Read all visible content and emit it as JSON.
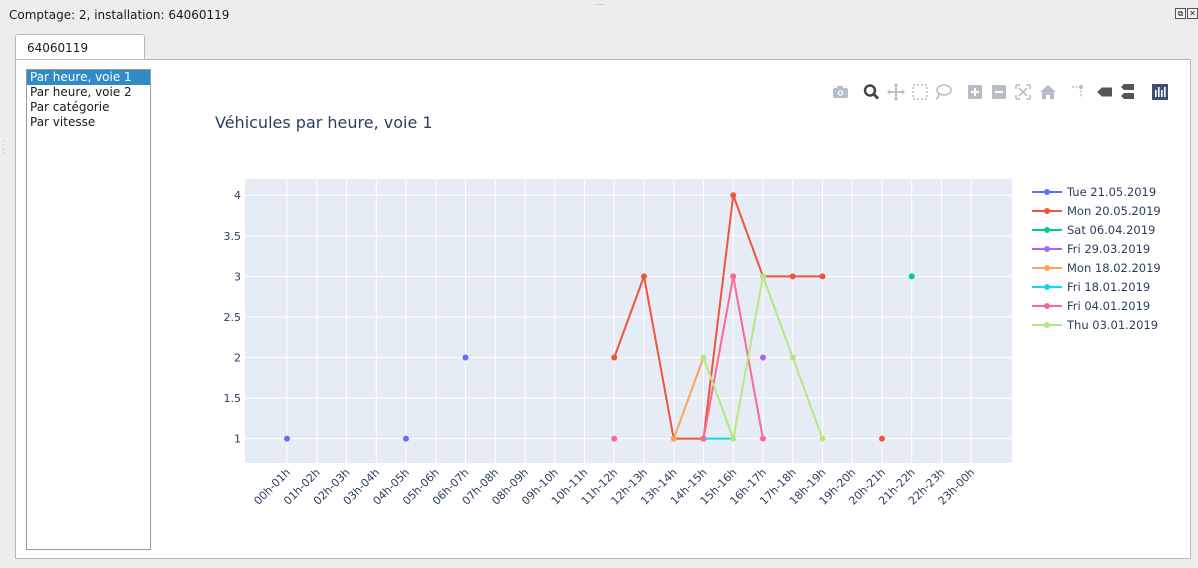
{
  "window": {
    "title": "Comptage: 2, installation: 64060119",
    "restore_icon": "restore-icon",
    "close_icon": "close-icon"
  },
  "tabs": [
    {
      "label": "64060119"
    }
  ],
  "sidebar": {
    "items": [
      {
        "label": "Par heure, voie 1",
        "selected": true
      },
      {
        "label": "Par heure, voie 2",
        "selected": false
      },
      {
        "label": "Par catégorie",
        "selected": false
      },
      {
        "label": "Par vitesse",
        "selected": false
      }
    ]
  },
  "modebar": {
    "buttons": [
      "camera-icon",
      "zoom-icon",
      "pan-icon",
      "box-select-icon",
      "lasso-select-icon",
      "zoom-in-icon",
      "zoom-out-icon",
      "autoscale-icon",
      "reset-axes-icon",
      "spike-lines-icon",
      "hover-closest-icon",
      "hover-compare-icon",
      "plotly-logo-icon"
    ],
    "active": [
      "zoom-icon"
    ]
  },
  "chart_data": {
    "type": "line",
    "title": "Véhicules par heure, voie 1",
    "categories": [
      "00h-01h",
      "01h-02h",
      "02h-03h",
      "03h-04h",
      "04h-05h",
      "05h-06h",
      "06h-07h",
      "07h-08h",
      "08h-09h",
      "09h-10h",
      "10h-11h",
      "11h-12h",
      "12h-13h",
      "13h-14h",
      "14h-15h",
      "15h-16h",
      "16h-17h",
      "17h-18h",
      "18h-19h",
      "19h-20h",
      "20h-21h",
      "21h-22h",
      "22h-23h",
      "23h-00h"
    ],
    "ylim": [
      0.7,
      4.2
    ],
    "yticks": [
      1,
      1.5,
      2,
      2.5,
      3,
      3.5,
      4
    ],
    "ytick_labels": [
      "1",
      "1.5",
      "2",
      "2.5",
      "3",
      "3.5",
      "4"
    ],
    "grid": true,
    "legend_position": "right",
    "series": [
      {
        "name": "Tue 21.05.2019",
        "color": "#636efa",
        "values": [
          1,
          null,
          null,
          null,
          1,
          null,
          2,
          null,
          null,
          null,
          null,
          null,
          null,
          null,
          null,
          null,
          null,
          null,
          null,
          null,
          null,
          null,
          null,
          null
        ]
      },
      {
        "name": "Mon 20.05.2019",
        "color": "#EF553B",
        "values": [
          null,
          null,
          null,
          null,
          null,
          null,
          null,
          null,
          null,
          null,
          null,
          2,
          3,
          1,
          1,
          4,
          3,
          3,
          3,
          null,
          1,
          null,
          null,
          null
        ]
      },
      {
        "name": "Sat 06.04.2019",
        "color": "#00cc96",
        "values": [
          null,
          null,
          null,
          null,
          null,
          null,
          null,
          null,
          null,
          null,
          null,
          null,
          null,
          null,
          null,
          null,
          null,
          null,
          null,
          null,
          null,
          3,
          null,
          null
        ]
      },
      {
        "name": "Fri 29.03.2019",
        "color": "#ab63fa",
        "values": [
          null,
          null,
          null,
          null,
          null,
          null,
          null,
          null,
          null,
          null,
          null,
          null,
          null,
          null,
          null,
          null,
          2,
          null,
          null,
          null,
          null,
          null,
          null,
          null
        ]
      },
      {
        "name": "Mon 18.02.2019",
        "color": "#FFA15A",
        "values": [
          null,
          null,
          null,
          null,
          null,
          null,
          null,
          null,
          null,
          null,
          null,
          null,
          null,
          1,
          2,
          null,
          null,
          null,
          null,
          null,
          null,
          null,
          null,
          null
        ]
      },
      {
        "name": "Fri 18.01.2019",
        "color": "#19d3f3",
        "values": [
          null,
          null,
          null,
          null,
          null,
          null,
          null,
          null,
          null,
          null,
          null,
          null,
          null,
          null,
          1,
          1,
          null,
          null,
          null,
          null,
          null,
          null,
          null,
          null
        ]
      },
      {
        "name": "Fri 04.01.2019",
        "color": "#FF6692",
        "values": [
          null,
          null,
          null,
          null,
          null,
          null,
          null,
          null,
          null,
          null,
          null,
          1,
          null,
          null,
          1,
          3,
          1,
          null,
          null,
          null,
          null,
          null,
          null,
          null
        ]
      },
      {
        "name": "Thu 03.01.2019",
        "color": "#B6E880",
        "values": [
          null,
          null,
          null,
          null,
          null,
          null,
          null,
          null,
          null,
          null,
          null,
          null,
          null,
          null,
          2,
          1,
          3,
          2,
          1,
          null,
          null,
          null,
          null,
          null
        ]
      }
    ]
  }
}
